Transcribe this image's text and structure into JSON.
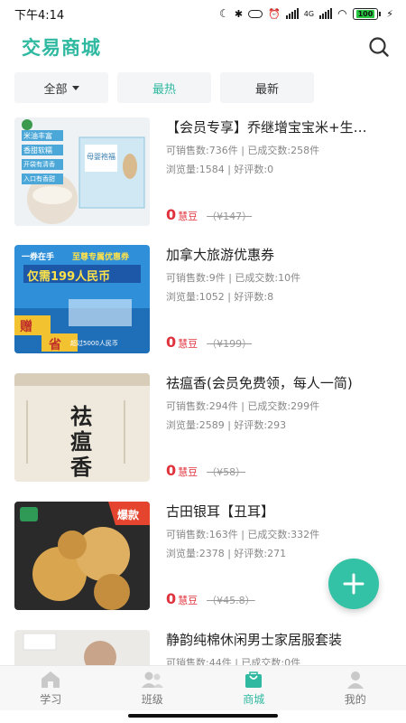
{
  "status": {
    "time": "下午4:14",
    "network": "4G",
    "battery": "100"
  },
  "header": {
    "title": "交易商城"
  },
  "filters": [
    {
      "label": "全部"
    },
    {
      "label": "最热"
    },
    {
      "label": "最新"
    }
  ],
  "products": [
    {
      "title": "【会员专享】乔继增宝宝米+生…",
      "sellable": "可销售数:736件",
      "sold": "已成交数:258件",
      "views": "浏览量:1584",
      "reviews": "好评数:0",
      "price": "0",
      "unit": "慧豆",
      "orig": "（¥147）",
      "thumb_text": [
        "米油丰富",
        "香甜软糯",
        "开袋有清香",
        "入口有香甜",
        "母婴袍福"
      ]
    },
    {
      "title": "加拿大旅游优惠券",
      "sellable": "可销售数:9件",
      "sold": "已成交数:10件",
      "views": "浏览量:1052",
      "reviews": "好评数:8",
      "price": "0",
      "unit": "慧豆",
      "orig": "（¥199）",
      "thumb_text": [
        "一券在手",
        "至尊专属优惠券",
        "仅需199人民币",
        "赠",
        "省",
        "超过5000人民币"
      ]
    },
    {
      "title": "祛瘟香(会员免费领，每人一简)",
      "sellable": "可销售数:294件",
      "sold": "已成交数:299件",
      "views": "浏览量:2589",
      "reviews": "好评数:293",
      "price": "0",
      "unit": "慧豆",
      "orig": "（¥58）",
      "thumb_text": [
        "祛",
        "瘟",
        "香"
      ]
    },
    {
      "title": "古田银耳【丑耳】",
      "sellable": "可销售数:163件",
      "sold": "已成交数:332件",
      "views": "浏览量:2378",
      "reviews": "好评数:271",
      "price": "0",
      "unit": "慧豆",
      "orig": "（¥45.8）",
      "thumb_text": [
        "爆款"
      ]
    },
    {
      "title": "静韵纯棉休闲男士家居服套装",
      "sellable": "可销售数:44件",
      "sold": "已成交数:0件",
      "views": "",
      "reviews": "",
      "price": "",
      "unit": "",
      "orig": ""
    }
  ],
  "nav": [
    {
      "label": "学习",
      "icon": "home-icon"
    },
    {
      "label": "班级",
      "icon": "users-icon"
    },
    {
      "label": "商城",
      "icon": "bag-icon"
    },
    {
      "label": "我的",
      "icon": "person-icon"
    }
  ],
  "colors": {
    "accent": "#2fb9a0",
    "price": "#e0323c",
    "fab": "#33c2a6"
  }
}
